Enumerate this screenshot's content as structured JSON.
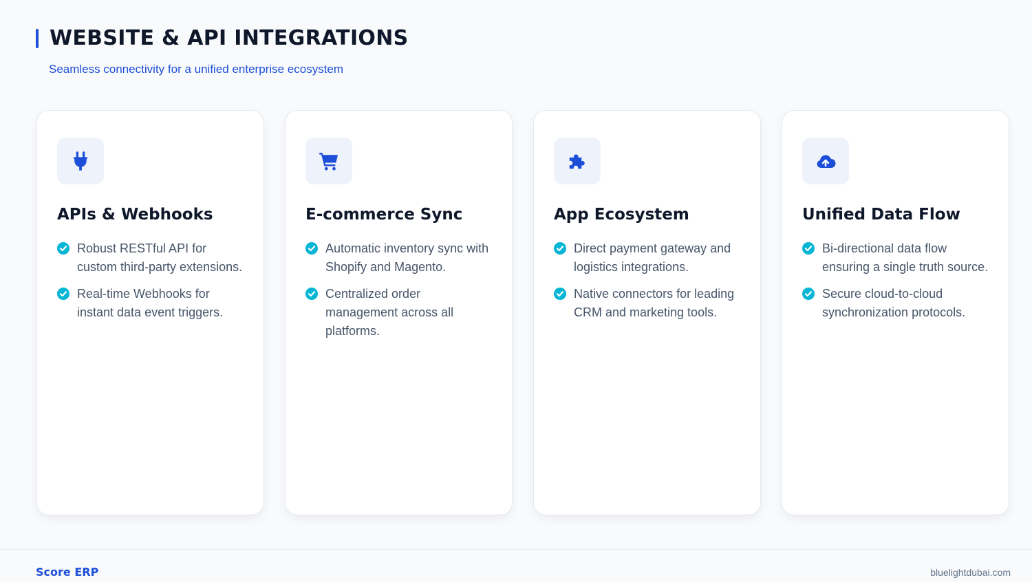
{
  "header": {
    "title": "WEBSITE & API INTEGRATIONS",
    "subtitle": "Seamless connectivity for a unified enterprise ecosystem"
  },
  "colors": {
    "accent": "#1d4ed8",
    "check": "#06b6d4",
    "icon_bg": "#eef2fb"
  },
  "cards": [
    {
      "icon": "plug-icon",
      "title": "APIs & Webhooks",
      "features": [
        "Robust RESTful API for custom third-party extensions.",
        "Real-time Webhooks for instant data event triggers."
      ]
    },
    {
      "icon": "shopping-cart-icon",
      "title": "E-commerce Sync",
      "features": [
        "Automatic inventory sync with Shopify and Magento.",
        "Centralized order management across all platforms."
      ]
    },
    {
      "icon": "puzzle-piece-icon",
      "title": "App Ecosystem",
      "features": [
        "Direct payment gateway and logistics integrations.",
        "Native connectors for leading CRM and marketing tools."
      ]
    },
    {
      "icon": "cloud-upload-icon",
      "title": "Unified Data Flow",
      "features": [
        "Bi-directional data flow ensuring a single truth source.",
        "Secure cloud-to-cloud synchronization protocols."
      ]
    }
  ],
  "footer": {
    "brand": "Score ERP",
    "website": "bluelightdubai.com"
  }
}
